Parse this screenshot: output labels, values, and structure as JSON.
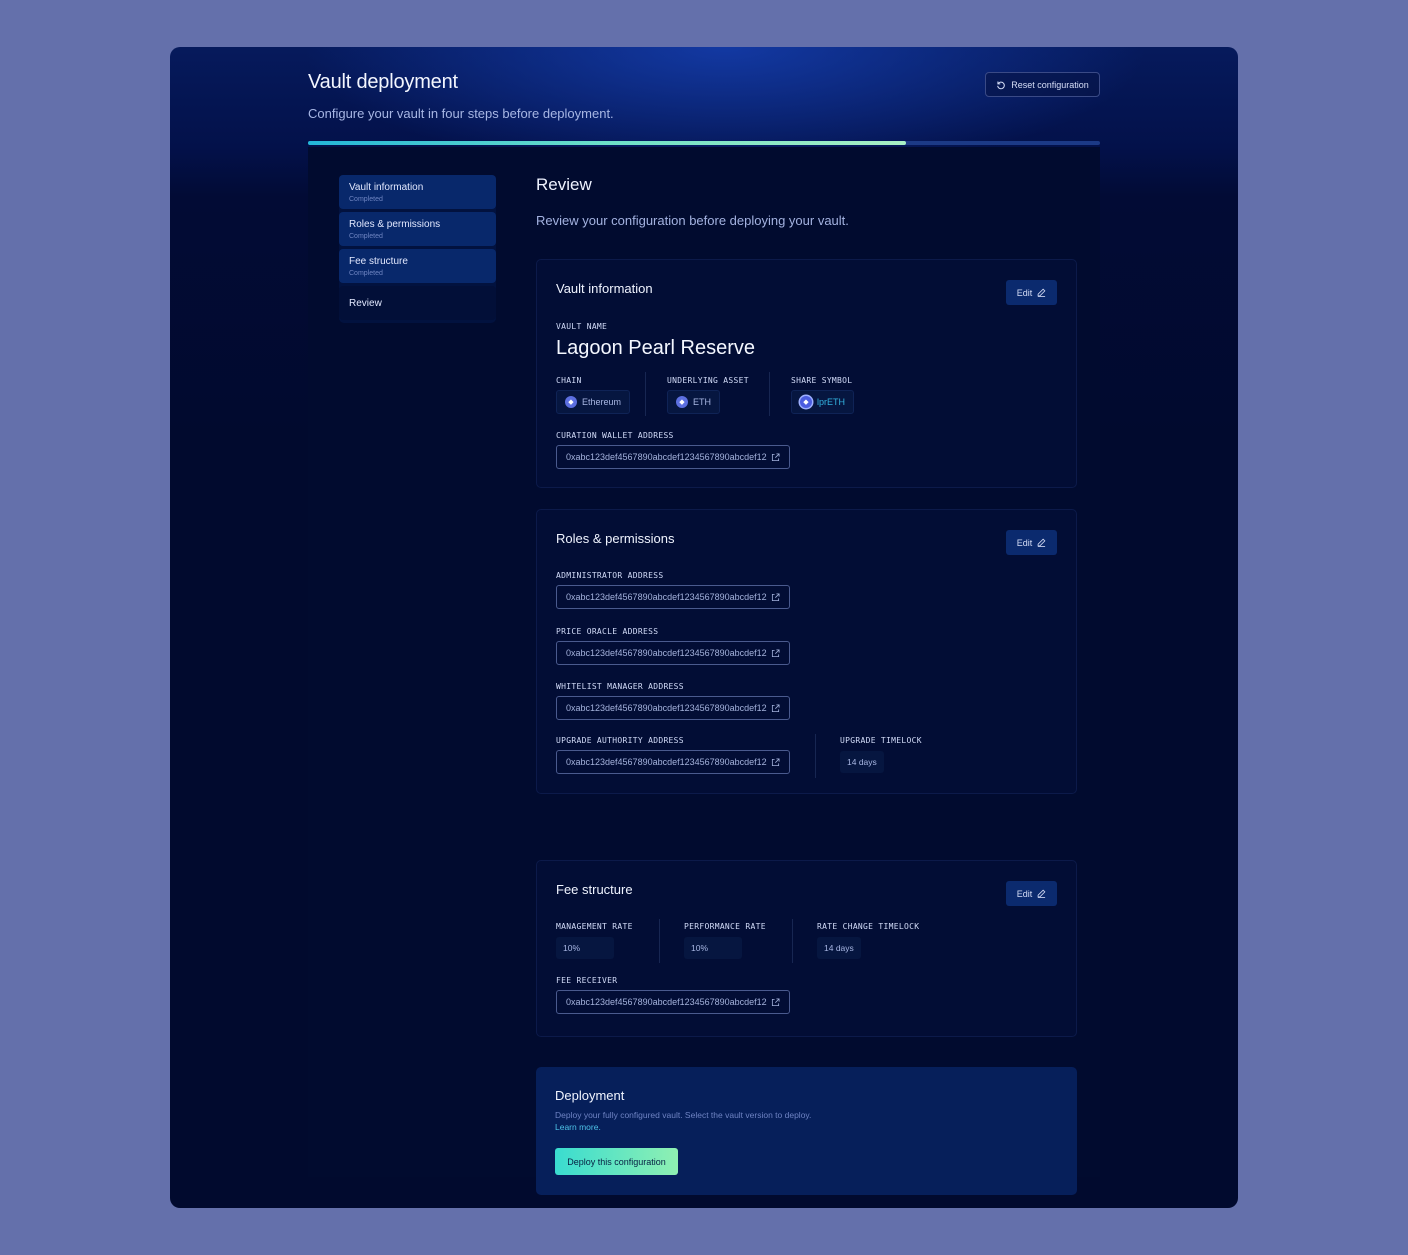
{
  "header": {
    "title": "Vault deployment",
    "subtitle": "Configure your vault in four steps before deployment.",
    "reset_label": "Reset configuration",
    "progress": 0.755
  },
  "stepper": {
    "steps": [
      {
        "label": "Vault information",
        "status": "Completed"
      },
      {
        "label": "Roles & permissions",
        "status": "Completed"
      },
      {
        "label": "Fee structure",
        "status": "Completed"
      },
      {
        "label": "Review",
        "status": ""
      }
    ]
  },
  "review": {
    "title": "Review",
    "subtitle": "Review your configuration before deploying your vault."
  },
  "edit_label": "Edit",
  "vault_info": {
    "title": "Vault information",
    "name_label": "VAULT NAME",
    "name": "Lagoon Pearl Reserve",
    "chain_label": "CHAIN",
    "chain": "Ethereum",
    "asset_label": "UNDERLYING ASSET",
    "asset": "ETH",
    "share_label": "SHARE SYMBOL",
    "share": "lprETH",
    "wallet_label": "CURATION WALLET ADDRESS",
    "wallet": "0xabc123def4567890abcdef1234567890abcdef12"
  },
  "roles": {
    "title": "Roles & permissions",
    "admin_label": "ADMINISTRATOR ADDRESS",
    "admin": "0xabc123def4567890abcdef1234567890abcdef12",
    "oracle_label": "PRICE ORACLE ADDRESS",
    "oracle": "0xabc123def4567890abcdef1234567890abcdef12",
    "whitelist_label": "WHITELIST MANAGER ADDRESS",
    "whitelist": "0xabc123def4567890abcdef1234567890abcdef12",
    "upgrade_label": "UPGRADE AUTHORITY ADDRESS",
    "upgrade": "0xabc123def4567890abcdef1234567890abcdef12",
    "timelock_label": "UPGRADE TIMELOCK",
    "timelock": "14 days"
  },
  "fees": {
    "title": "Fee structure",
    "mgmt_label": "MANAGEMENT RATE",
    "mgmt": "10%",
    "perf_label": "PERFORMANCE RATE",
    "perf": "10%",
    "timelock_label": "RATE CHANGE TIMELOCK",
    "timelock": "14 days",
    "receiver_label": "FEE RECEIVER",
    "receiver": "0xabc123def4567890abcdef1234567890abcdef12"
  },
  "deployment": {
    "title": "Deployment",
    "description": "Deploy your fully configured vault. Select the vault version to deploy.",
    "learn_more": "Learn more.",
    "button": "Deploy this configuration"
  },
  "colors": {
    "page_bg": "#6470ab",
    "frame_bg": "#010a2e",
    "accent_gradient_start": "#39dcd0",
    "accent_gradient_end": "#8ff0b2"
  }
}
